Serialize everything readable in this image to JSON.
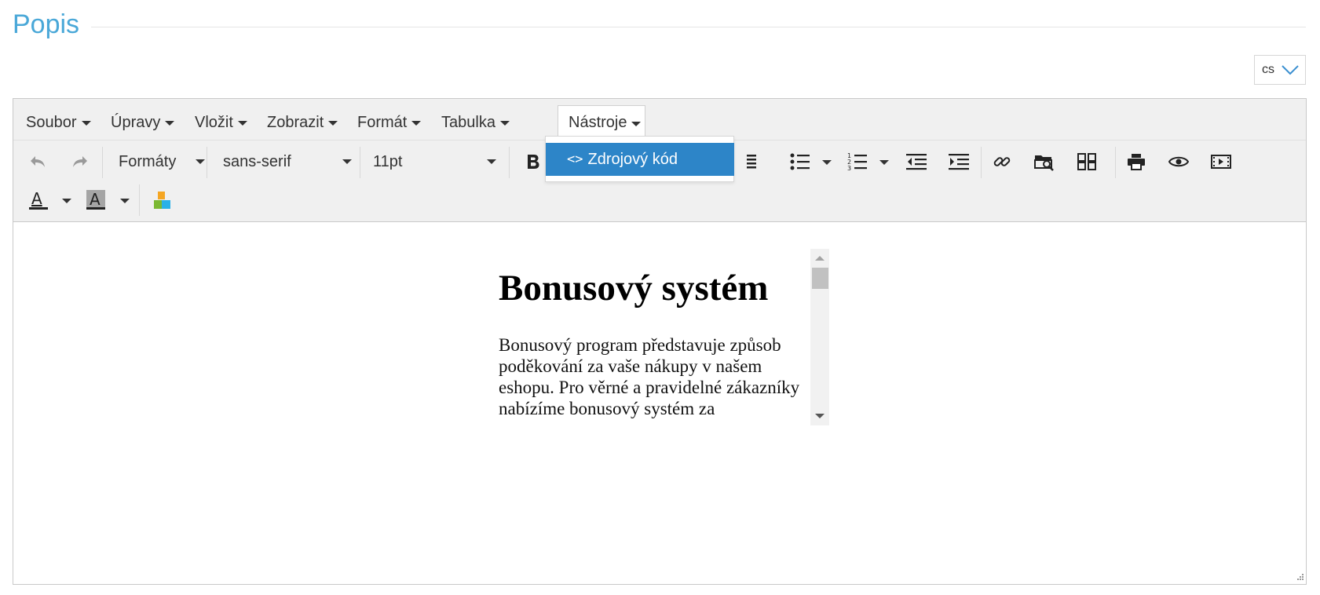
{
  "section": {
    "title": "Popis"
  },
  "language_select": {
    "value": "cs"
  },
  "menubar": {
    "items": [
      {
        "label": "Soubor"
      },
      {
        "label": "Úpravy"
      },
      {
        "label": "Vložit"
      },
      {
        "label": "Zobrazit"
      },
      {
        "label": "Formát"
      },
      {
        "label": "Tabulka"
      },
      {
        "label": "Nástroje"
      }
    ],
    "active": "Nástroje"
  },
  "toolbar": {
    "formats_label": "Formáty",
    "font_family": "sans-serif",
    "font_size": "11pt"
  },
  "tools_dropdown": {
    "items": [
      {
        "label": "Zdrojový kód",
        "icon": "code-icon"
      }
    ]
  },
  "content": {
    "heading": "Bonusový systém",
    "paragraph": "Bonusový program představuje způsob poděkování za vaše nákupy v našem eshopu. Pro věrné a pravidelné zákazníky nabízíme bonusový systém za"
  },
  "colors": {
    "title": "#4aa8d8",
    "accent": "#2d85c8",
    "toolbar_bg": "#f0f0f0",
    "disabled_icon": "#9a9a9a"
  }
}
